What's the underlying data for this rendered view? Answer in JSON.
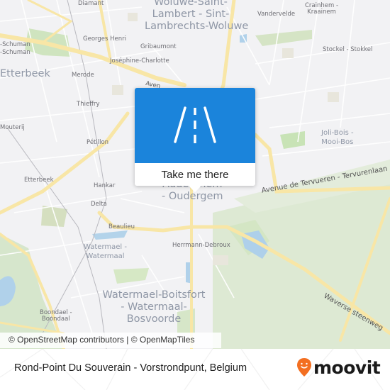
{
  "map": {
    "labels": {
      "diamant": "Diamant",
      "woluwe": [
        "Woluwe-Saint-",
        "Lambert - Sint-",
        "Lambrechts-Woluwe"
      ],
      "vandervelde": "Vandervelde",
      "crainhem": [
        "Crainhem -",
        "Kraainem"
      ],
      "schuman1": "-Schuman",
      "schuman2": "-Schuman",
      "georges_henri": "Georges Henri",
      "gribaumont": "Gribaumont",
      "stockel": "Stockel - Stokkel",
      "josephine": "Joséphine-Charlotte",
      "etterbeek_big": "Etterbeek",
      "merode": "Merode",
      "thieffry": "Thieffry",
      "mouterij": "Mouterij",
      "petillon": "Pétillon",
      "joli_bois": [
        "Joli-Bois -",
        "Mooi-Bos"
      ],
      "etterbeek_small": "Etterbeek",
      "hankar": "Hankar",
      "delta": "Delta",
      "auderghem": [
        "Auderghem",
        "- Oudergem"
      ],
      "avenue_tervueren": "Avenue de Tervueren - Tervurenlaan",
      "beaulieu": "Beaulieu",
      "watermael": [
        "Watermael -",
        "Watermaal"
      ],
      "herrmann": "Herrmann-Debroux",
      "watermael_boitsfort": [
        "Watermael-Boitsfort",
        "- Watermaal-",
        "Bosvoorde"
      ],
      "waverse": "Waverse steenweg",
      "boondael": [
        "Boondael -",
        "Boondaal"
      ],
      "avenue_partial": "Aven"
    },
    "attribution": "© OpenStreetMap contributors | © OpenMapTiles"
  },
  "popup": {
    "icon": "road-icon",
    "cta_label": "Take me there",
    "color": "#1b84db"
  },
  "footer": {
    "place_name": "Rond-Point Du Souverain - Vorstrondpunt, Belgium",
    "brand": "moovit",
    "brand_color": "#f36f21"
  }
}
